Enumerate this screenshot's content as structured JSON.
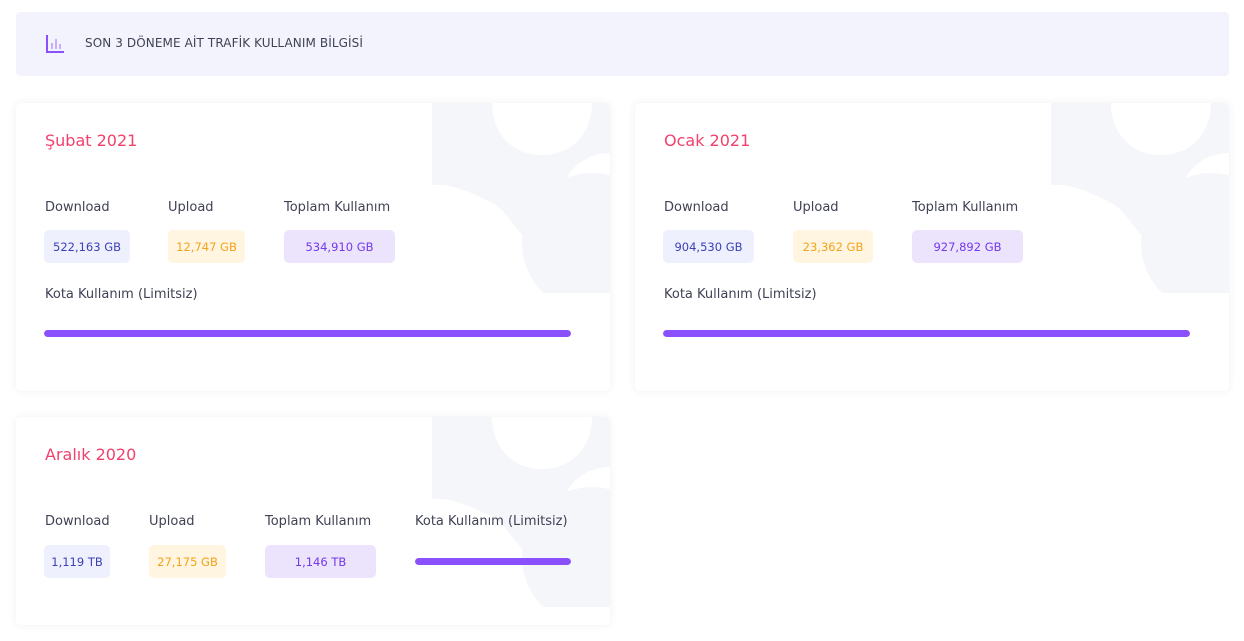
{
  "header": {
    "title": "SON 3 DÖNEME AİT TRAFİK KULLANIM BİLGİSİ",
    "icon": "bar-chart-icon"
  },
  "labels": {
    "download": "Download",
    "upload": "Upload",
    "total": "Toplam Kullanım",
    "quota": "Kota Kullanım (Limitsiz)"
  },
  "colors": {
    "period_title": "#f1416c",
    "progress": "#8950fc",
    "download_badge": "#eef0fe",
    "upload_badge": "#fff5e0",
    "total_badge": "#ece3fd"
  },
  "periods": [
    {
      "name": "Şubat 2021",
      "download": "522,163 GB",
      "upload": "12,747 GB",
      "total": "534,910 GB",
      "quota_progress": 1.0
    },
    {
      "name": "Ocak 2021",
      "download": "904,530 GB",
      "upload": "23,362 GB",
      "total": "927,892 GB",
      "quota_progress": 1.0
    },
    {
      "name": "Aralık 2020",
      "download": "1,119 TB",
      "upload": "27,175 GB",
      "total": "1,146 TB",
      "quota_progress": 1.0
    }
  ]
}
